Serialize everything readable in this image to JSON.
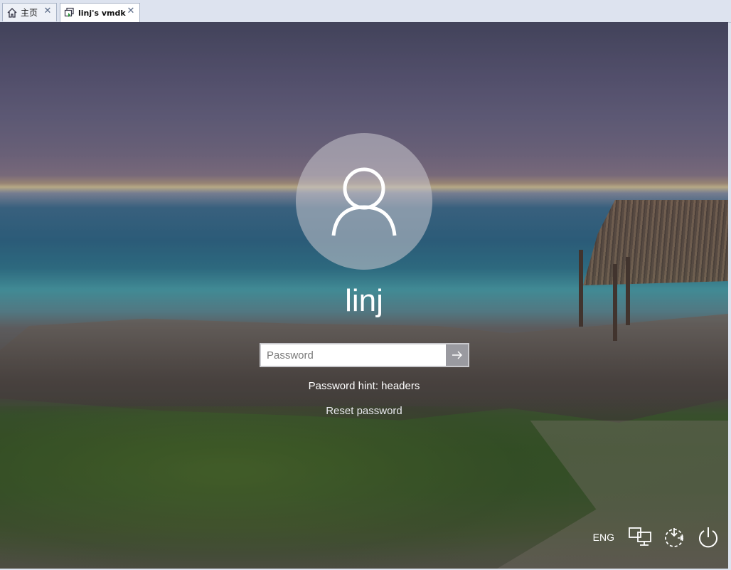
{
  "tabs": [
    {
      "label": "主页",
      "icon": "home-icon",
      "active": false
    },
    {
      "label": "linj's vmdk",
      "icon": "vm-icon",
      "active": true
    }
  ],
  "lock_screen": {
    "username": "linj",
    "password_placeholder": "Password",
    "password_value": "",
    "password_hint": "Password hint: headers",
    "reset_link": "Reset password",
    "language": "ENG",
    "tray_icons": [
      "network-icon",
      "ease-of-access-icon",
      "power-icon"
    ]
  },
  "colors": {
    "tab_bg": "#dde3ef",
    "text_white": "#ffffff",
    "submit_bg": "#78787f"
  }
}
